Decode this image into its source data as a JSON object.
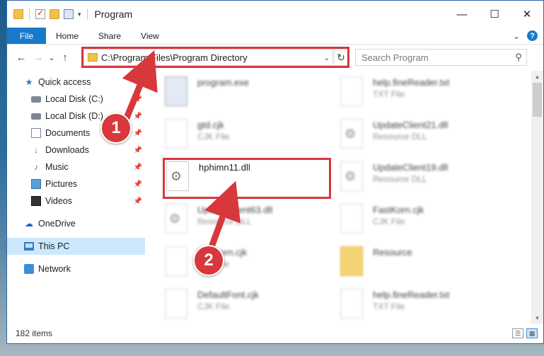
{
  "window": {
    "title": "Program",
    "minimize": "—",
    "maximize": "☐",
    "close": "✕"
  },
  "ribbon": {
    "tabs": [
      "File",
      "Home",
      "Share",
      "View"
    ],
    "expand": "⌄",
    "help": "?"
  },
  "address": {
    "back": "←",
    "forward": "→",
    "recent": "⌄",
    "up": "↑",
    "path": "C:\\Program Files\\Program Directory",
    "dropdown": "⌄",
    "refresh": "↻",
    "search_placeholder": "Search Program",
    "search_icon": "search-icon"
  },
  "sidebar": {
    "items": [
      {
        "label": "Quick access",
        "icon": "star-icon"
      },
      {
        "label": "Local Disk (C:)",
        "icon": "drive-icon",
        "pinned": true
      },
      {
        "label": "Local Disk (D:)",
        "icon": "drive-icon",
        "pinned": true
      },
      {
        "label": "Documents",
        "icon": "documents-icon",
        "pinned": true
      },
      {
        "label": "Downloads",
        "icon": "download-icon",
        "pinned": true
      },
      {
        "label": "Music",
        "icon": "music-icon",
        "pinned": true
      },
      {
        "label": "Pictures",
        "icon": "pictures-icon",
        "pinned": true
      },
      {
        "label": "Videos",
        "icon": "videos-icon",
        "pinned": true
      },
      {
        "label": "OneDrive",
        "icon": "cloud-icon"
      },
      {
        "label": "This PC",
        "icon": "computer-icon",
        "selected": true
      },
      {
        "label": "Network",
        "icon": "network-icon"
      }
    ]
  },
  "files": {
    "left": [
      {
        "name": "program.exe",
        "type": ""
      },
      {
        "name": "gtd.cjk",
        "type": "CJK File"
      },
      {
        "name": "hphimn11.dll",
        "type": ""
      },
      {
        "name": "UpdateClient63.dll",
        "type": "Resource DLL"
      },
      {
        "name": "Fastkorn.cjk",
        "type": "CJK File"
      },
      {
        "name": "DefaultFont.cjk",
        "type": "CJK File"
      }
    ],
    "right": [
      {
        "name": "help.fineReader.txt",
        "type": "TXT File"
      },
      {
        "name": "UpdateClient21.dll",
        "type": "Resource DLL"
      },
      {
        "name": "UpdateClient19.dll",
        "type": "Resource DLL"
      },
      {
        "name": "FastKorn.cjk",
        "type": "CJK File"
      },
      {
        "name": "Resource",
        "type": ""
      },
      {
        "name": "help.fineReader.txt",
        "type": "TXT File"
      }
    ]
  },
  "status": {
    "item_count": "182 items"
  },
  "callouts": [
    "1",
    "2"
  ],
  "colors": {
    "accent": "#1979ca",
    "highlight": "#d8373c",
    "selection": "#cce8ff"
  }
}
